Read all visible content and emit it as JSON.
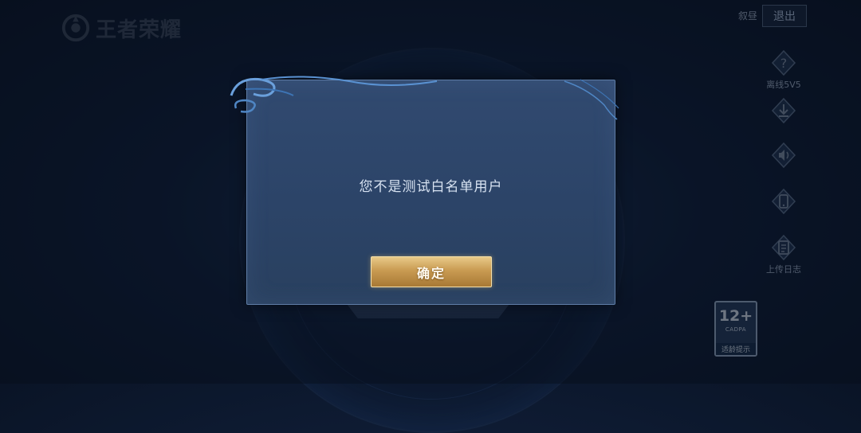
{
  "app": {
    "logo_text": "王者荣耀"
  },
  "header": {
    "user_name": "叙昼",
    "logout_label": "退出"
  },
  "side_menu": [
    {
      "icon": "question-icon",
      "label": "离线5V5"
    },
    {
      "icon": "download-icon",
      "label": ""
    },
    {
      "icon": "speaker-icon",
      "label": ""
    },
    {
      "icon": "phone-icon",
      "label": ""
    },
    {
      "icon": "clipboard-icon",
      "label": "上传日志"
    }
  ],
  "age_rating": {
    "age": "12+",
    "org": "CADPA",
    "tip": "适龄提示"
  },
  "dialog": {
    "message": "您不是测试白名单用户",
    "confirm_label": "确定"
  },
  "colors": {
    "accent_gold": "#c99b52",
    "dialog_bg": "#2c4468",
    "background": "#0f1d36"
  }
}
